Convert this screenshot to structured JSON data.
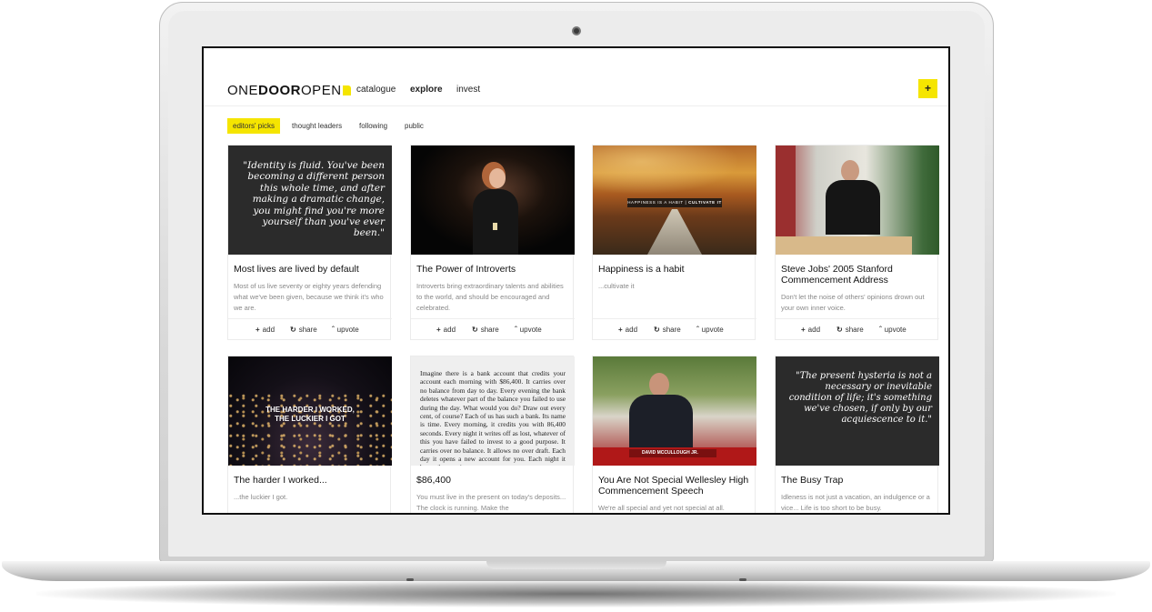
{
  "app": {
    "logo_thin1": "ONE",
    "logo_bold": "DOOR",
    "logo_thin2": "OPEN",
    "nav": [
      "catalogue",
      "explore",
      "invest"
    ],
    "plus": "+"
  },
  "subnav": [
    "editors' picks",
    "thought leaders",
    "following",
    "public"
  ],
  "actions": {
    "add": "add",
    "share": "share",
    "upvote": "upvote"
  },
  "cards": [
    {
      "title": "Most lives are lived by default",
      "desc": "Most of us live seventy or eighty years defending what we've been given, because we think it's who we are.",
      "quote": "\"Identity is fluid. You've been becoming a different person this whole time, and after making a dramatic change, you might find you're more yourself than you've ever been.\""
    },
    {
      "title": "The Power of Introverts",
      "desc": "Introverts bring extraordinary talents and abilities to the world, and should be encouraged and celebrated."
    },
    {
      "title": "Happiness is a habit",
      "desc": "...cultivate it",
      "overlay_a": "HAPPINESS IS A HABIT",
      "overlay_b": "CULTIVATE IT"
    },
    {
      "title": "Steve Jobs' 2005 Stanford Commencement Address",
      "desc": "Don't let the noise of others' opinions drown out your own inner voice."
    },
    {
      "title": "The harder I worked...",
      "desc": "...the luckier I got.",
      "overlay_a": "THE HARDER I WORKED,",
      "overlay_b": "THE LUCKIER I GOT"
    },
    {
      "title": "$86,400",
      "desc": "You must live in the present on today's deposits... The clock is running. Make the",
      "doc": "Imagine there is a bank account that credits your account each morning with $86,400. It carries over no balance from day to day. Every evening the bank deletes whatever part of the balance you failed to use during the day. What would you do? Draw out every cent, of course? Each of us has such a bank. Its name is time. Every morning, it credits you with 86,400 seconds. Every night it writes off as lost, whatever of this you have failed to invest to a good purpose. It carries over no balance. It allows no over draft. Each day it opens a new account for you. Each night it burns the remains"
    },
    {
      "title": "You Are Not Special Wellesley High Commencement Speech",
      "desc": "We're all special and yet not special at all.",
      "lower_third": "DAVID MCCULLOUGH JR."
    },
    {
      "title": "The Busy Trap",
      "desc": "Idleness is not just a vacation, an indulgence or a vice... Life is too short to be busy.",
      "quote": "\"The present hysteria is not a necessary or inevitable condition of life; it's something we've chosen, if only by our acquiescence to it.\""
    }
  ],
  "colors": {
    "accent": "#f5e500",
    "quote_bg": "#2b2b2b"
  }
}
